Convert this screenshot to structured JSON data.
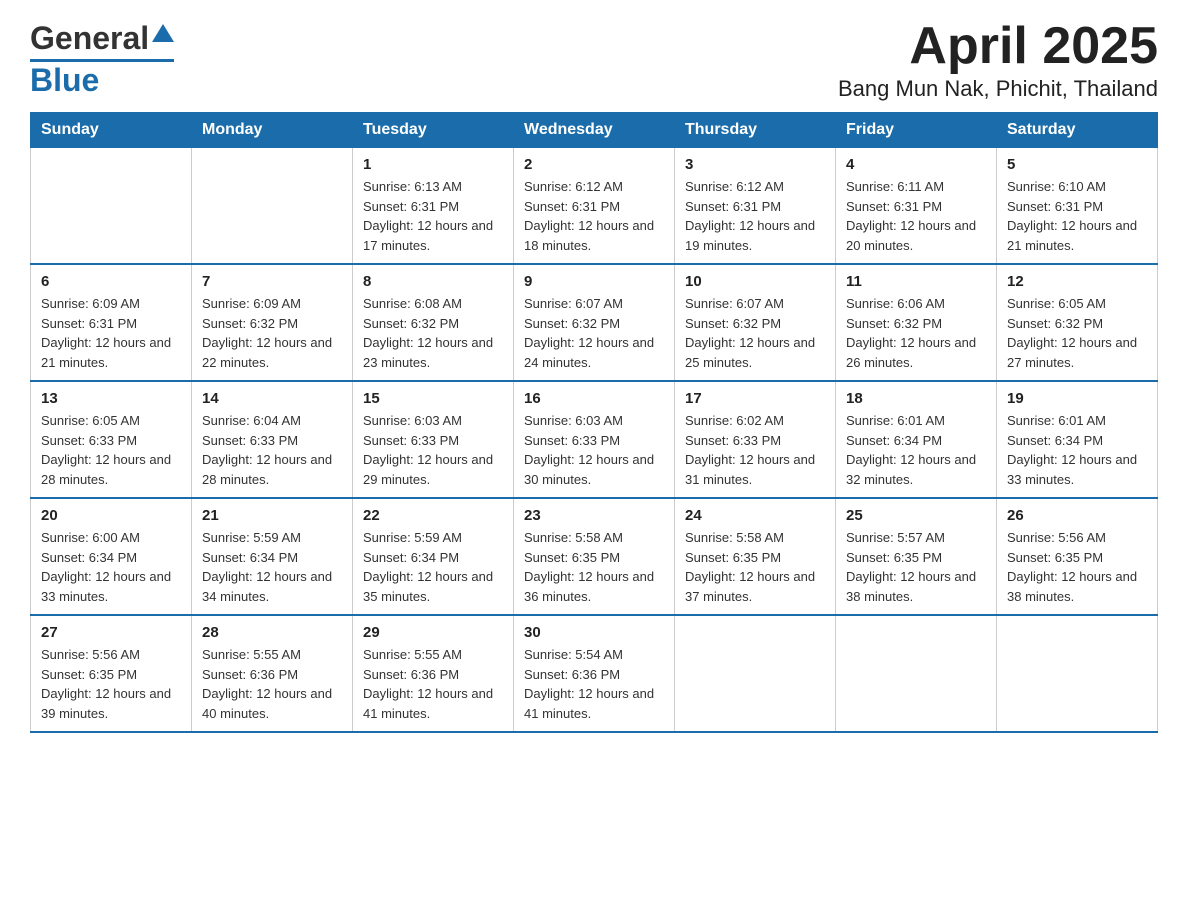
{
  "logo": {
    "text_general": "General",
    "text_blue": "Blue"
  },
  "title": "April 2025",
  "subtitle": "Bang Mun Nak, Phichit, Thailand",
  "days_of_week": [
    "Sunday",
    "Monday",
    "Tuesday",
    "Wednesday",
    "Thursday",
    "Friday",
    "Saturday"
  ],
  "weeks": [
    [
      {
        "day": "",
        "sunrise": "",
        "sunset": "",
        "daylight": ""
      },
      {
        "day": "",
        "sunrise": "",
        "sunset": "",
        "daylight": ""
      },
      {
        "day": "1",
        "sunrise": "Sunrise: 6:13 AM",
        "sunset": "Sunset: 6:31 PM",
        "daylight": "Daylight: 12 hours and 17 minutes."
      },
      {
        "day": "2",
        "sunrise": "Sunrise: 6:12 AM",
        "sunset": "Sunset: 6:31 PM",
        "daylight": "Daylight: 12 hours and 18 minutes."
      },
      {
        "day": "3",
        "sunrise": "Sunrise: 6:12 AM",
        "sunset": "Sunset: 6:31 PM",
        "daylight": "Daylight: 12 hours and 19 minutes."
      },
      {
        "day": "4",
        "sunrise": "Sunrise: 6:11 AM",
        "sunset": "Sunset: 6:31 PM",
        "daylight": "Daylight: 12 hours and 20 minutes."
      },
      {
        "day": "5",
        "sunrise": "Sunrise: 6:10 AM",
        "sunset": "Sunset: 6:31 PM",
        "daylight": "Daylight: 12 hours and 21 minutes."
      }
    ],
    [
      {
        "day": "6",
        "sunrise": "Sunrise: 6:09 AM",
        "sunset": "Sunset: 6:31 PM",
        "daylight": "Daylight: 12 hours and 21 minutes."
      },
      {
        "day": "7",
        "sunrise": "Sunrise: 6:09 AM",
        "sunset": "Sunset: 6:32 PM",
        "daylight": "Daylight: 12 hours and 22 minutes."
      },
      {
        "day": "8",
        "sunrise": "Sunrise: 6:08 AM",
        "sunset": "Sunset: 6:32 PM",
        "daylight": "Daylight: 12 hours and 23 minutes."
      },
      {
        "day": "9",
        "sunrise": "Sunrise: 6:07 AM",
        "sunset": "Sunset: 6:32 PM",
        "daylight": "Daylight: 12 hours and 24 minutes."
      },
      {
        "day": "10",
        "sunrise": "Sunrise: 6:07 AM",
        "sunset": "Sunset: 6:32 PM",
        "daylight": "Daylight: 12 hours and 25 minutes."
      },
      {
        "day": "11",
        "sunrise": "Sunrise: 6:06 AM",
        "sunset": "Sunset: 6:32 PM",
        "daylight": "Daylight: 12 hours and 26 minutes."
      },
      {
        "day": "12",
        "sunrise": "Sunrise: 6:05 AM",
        "sunset": "Sunset: 6:32 PM",
        "daylight": "Daylight: 12 hours and 27 minutes."
      }
    ],
    [
      {
        "day": "13",
        "sunrise": "Sunrise: 6:05 AM",
        "sunset": "Sunset: 6:33 PM",
        "daylight": "Daylight: 12 hours and 28 minutes."
      },
      {
        "day": "14",
        "sunrise": "Sunrise: 6:04 AM",
        "sunset": "Sunset: 6:33 PM",
        "daylight": "Daylight: 12 hours and 28 minutes."
      },
      {
        "day": "15",
        "sunrise": "Sunrise: 6:03 AM",
        "sunset": "Sunset: 6:33 PM",
        "daylight": "Daylight: 12 hours and 29 minutes."
      },
      {
        "day": "16",
        "sunrise": "Sunrise: 6:03 AM",
        "sunset": "Sunset: 6:33 PM",
        "daylight": "Daylight: 12 hours and 30 minutes."
      },
      {
        "day": "17",
        "sunrise": "Sunrise: 6:02 AM",
        "sunset": "Sunset: 6:33 PM",
        "daylight": "Daylight: 12 hours and 31 minutes."
      },
      {
        "day": "18",
        "sunrise": "Sunrise: 6:01 AM",
        "sunset": "Sunset: 6:34 PM",
        "daylight": "Daylight: 12 hours and 32 minutes."
      },
      {
        "day": "19",
        "sunrise": "Sunrise: 6:01 AM",
        "sunset": "Sunset: 6:34 PM",
        "daylight": "Daylight: 12 hours and 33 minutes."
      }
    ],
    [
      {
        "day": "20",
        "sunrise": "Sunrise: 6:00 AM",
        "sunset": "Sunset: 6:34 PM",
        "daylight": "Daylight: 12 hours and 33 minutes."
      },
      {
        "day": "21",
        "sunrise": "Sunrise: 5:59 AM",
        "sunset": "Sunset: 6:34 PM",
        "daylight": "Daylight: 12 hours and 34 minutes."
      },
      {
        "day": "22",
        "sunrise": "Sunrise: 5:59 AM",
        "sunset": "Sunset: 6:34 PM",
        "daylight": "Daylight: 12 hours and 35 minutes."
      },
      {
        "day": "23",
        "sunrise": "Sunrise: 5:58 AM",
        "sunset": "Sunset: 6:35 PM",
        "daylight": "Daylight: 12 hours and 36 minutes."
      },
      {
        "day": "24",
        "sunrise": "Sunrise: 5:58 AM",
        "sunset": "Sunset: 6:35 PM",
        "daylight": "Daylight: 12 hours and 37 minutes."
      },
      {
        "day": "25",
        "sunrise": "Sunrise: 5:57 AM",
        "sunset": "Sunset: 6:35 PM",
        "daylight": "Daylight: 12 hours and 38 minutes."
      },
      {
        "day": "26",
        "sunrise": "Sunrise: 5:56 AM",
        "sunset": "Sunset: 6:35 PM",
        "daylight": "Daylight: 12 hours and 38 minutes."
      }
    ],
    [
      {
        "day": "27",
        "sunrise": "Sunrise: 5:56 AM",
        "sunset": "Sunset: 6:35 PM",
        "daylight": "Daylight: 12 hours and 39 minutes."
      },
      {
        "day": "28",
        "sunrise": "Sunrise: 5:55 AM",
        "sunset": "Sunset: 6:36 PM",
        "daylight": "Daylight: 12 hours and 40 minutes."
      },
      {
        "day": "29",
        "sunrise": "Sunrise: 5:55 AM",
        "sunset": "Sunset: 6:36 PM",
        "daylight": "Daylight: 12 hours and 41 minutes."
      },
      {
        "day": "30",
        "sunrise": "Sunrise: 5:54 AM",
        "sunset": "Sunset: 6:36 PM",
        "daylight": "Daylight: 12 hours and 41 minutes."
      },
      {
        "day": "",
        "sunrise": "",
        "sunset": "",
        "daylight": ""
      },
      {
        "day": "",
        "sunrise": "",
        "sunset": "",
        "daylight": ""
      },
      {
        "day": "",
        "sunrise": "",
        "sunset": "",
        "daylight": ""
      }
    ]
  ]
}
